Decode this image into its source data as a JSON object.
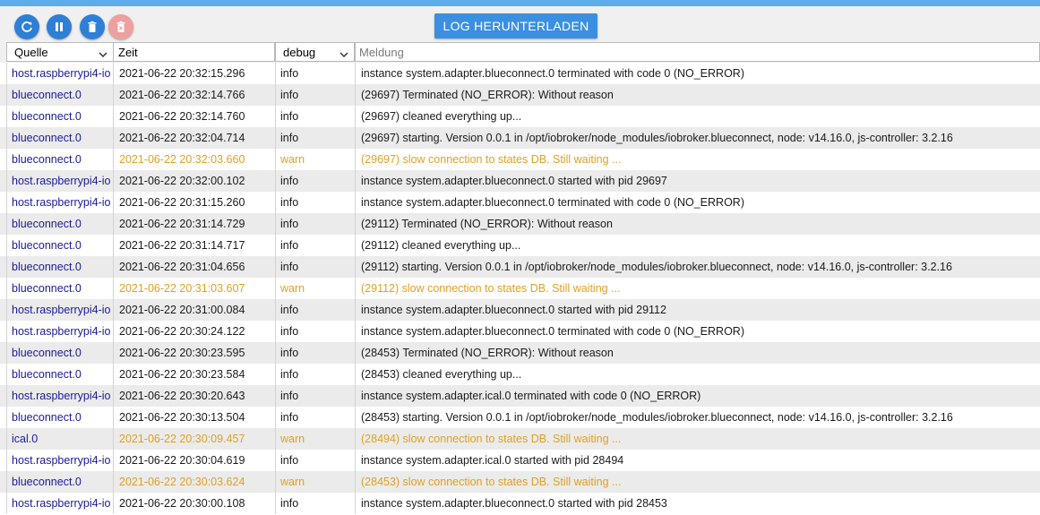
{
  "toolbar": {
    "download_label": "LOG HERUNTERLADEN",
    "buttons": [
      "refresh-icon",
      "pause-icon",
      "delete-icon",
      "delete-disabled-icon"
    ]
  },
  "filters": {
    "source": "Quelle",
    "time": "Zeit",
    "severity": "debug",
    "message_placeholder": "Meldung"
  },
  "colors": {
    "accent": "#3b8fe0",
    "source_text": "#1a1a9c",
    "warn_text": "#e0a021",
    "disabled_button": "#ee9f9f"
  },
  "log": [
    {
      "source": "host.raspberrypi4-io",
      "time": "2021-06-22 20:32:15.296",
      "severity": "info",
      "message": "instance system.adapter.blueconnect.0 terminated with code 0 (NO_ERROR)"
    },
    {
      "source": "blueconnect.0",
      "time": "2021-06-22 20:32:14.766",
      "severity": "info",
      "message": "(29697) Terminated (NO_ERROR): Without reason"
    },
    {
      "source": "blueconnect.0",
      "time": "2021-06-22 20:32:14.760",
      "severity": "info",
      "message": "(29697) cleaned everything up..."
    },
    {
      "source": "blueconnect.0",
      "time": "2021-06-22 20:32:04.714",
      "severity": "info",
      "message": "(29697) starting. Version 0.0.1 in /opt/iobroker/node_modules/iobroker.blueconnect, node: v14.16.0, js-controller: 3.2.16"
    },
    {
      "source": "blueconnect.0",
      "time": "2021-06-22 20:32:03.660",
      "severity": "warn",
      "message": "(29697) slow connection to states DB. Still waiting ..."
    },
    {
      "source": "host.raspberrypi4-io",
      "time": "2021-06-22 20:32:00.102",
      "severity": "info",
      "message": "instance system.adapter.blueconnect.0 started with pid 29697"
    },
    {
      "source": "host.raspberrypi4-io",
      "time": "2021-06-22 20:31:15.260",
      "severity": "info",
      "message": "instance system.adapter.blueconnect.0 terminated with code 0 (NO_ERROR)"
    },
    {
      "source": "blueconnect.0",
      "time": "2021-06-22 20:31:14.729",
      "severity": "info",
      "message": "(29112) Terminated (NO_ERROR): Without reason"
    },
    {
      "source": "blueconnect.0",
      "time": "2021-06-22 20:31:14.717",
      "severity": "info",
      "message": "(29112) cleaned everything up..."
    },
    {
      "source": "blueconnect.0",
      "time": "2021-06-22 20:31:04.656",
      "severity": "info",
      "message": "(29112) starting. Version 0.0.1 in /opt/iobroker/node_modules/iobroker.blueconnect, node: v14.16.0, js-controller: 3.2.16"
    },
    {
      "source": "blueconnect.0",
      "time": "2021-06-22 20:31:03.607",
      "severity": "warn",
      "message": "(29112) slow connection to states DB. Still waiting ..."
    },
    {
      "source": "host.raspberrypi4-io",
      "time": "2021-06-22 20:31:00.084",
      "severity": "info",
      "message": "instance system.adapter.blueconnect.0 started with pid 29112"
    },
    {
      "source": "host.raspberrypi4-io",
      "time": "2021-06-22 20:30:24.122",
      "severity": "info",
      "message": "instance system.adapter.blueconnect.0 terminated with code 0 (NO_ERROR)"
    },
    {
      "source": "blueconnect.0",
      "time": "2021-06-22 20:30:23.595",
      "severity": "info",
      "message": "(28453) Terminated (NO_ERROR): Without reason"
    },
    {
      "source": "blueconnect.0",
      "time": "2021-06-22 20:30:23.584",
      "severity": "info",
      "message": "(28453) cleaned everything up..."
    },
    {
      "source": "host.raspberrypi4-io",
      "time": "2021-06-22 20:30:20.643",
      "severity": "info",
      "message": "instance system.adapter.ical.0 terminated with code 0 (NO_ERROR)"
    },
    {
      "source": "blueconnect.0",
      "time": "2021-06-22 20:30:13.504",
      "severity": "info",
      "message": "(28453) starting. Version 0.0.1 in /opt/iobroker/node_modules/iobroker.blueconnect, node: v14.16.0, js-controller: 3.2.16"
    },
    {
      "source": "ical.0",
      "time": "2021-06-22 20:30:09.457",
      "severity": "warn",
      "message": "(28494) slow connection to states DB. Still waiting ..."
    },
    {
      "source": "host.raspberrypi4-io",
      "time": "2021-06-22 20:30:04.619",
      "severity": "info",
      "message": "instance system.adapter.ical.0 started with pid 28494"
    },
    {
      "source": "blueconnect.0",
      "time": "2021-06-22 20:30:03.624",
      "severity": "warn",
      "message": "(28453) slow connection to states DB. Still waiting ..."
    },
    {
      "source": "host.raspberrypi4-io",
      "time": "2021-06-22 20:30:00.108",
      "severity": "info",
      "message": "instance system.adapter.blueconnect.0 started with pid 28453"
    }
  ]
}
